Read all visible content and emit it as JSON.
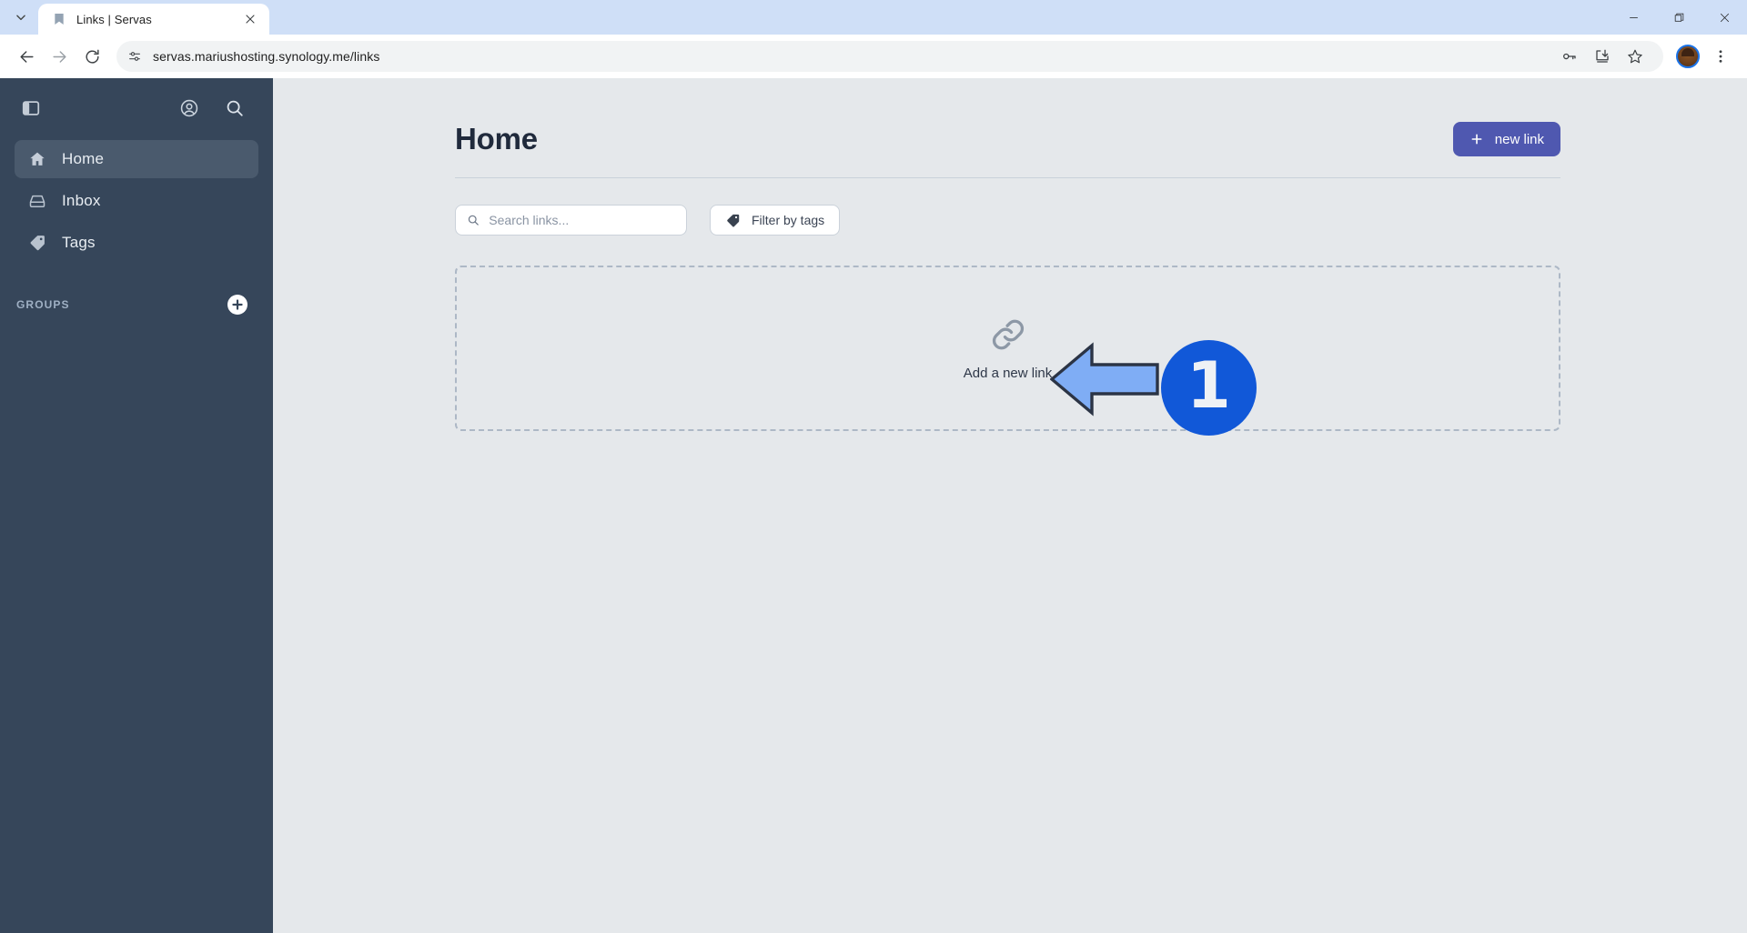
{
  "browser": {
    "tab": {
      "title": "Links | Servas",
      "favicon_name": "servas-bookmark-favicon",
      "close_label": "×"
    },
    "tab_search_label": "Search tabs",
    "toolbar": {
      "back_label": "Back",
      "forward_label": "Forward",
      "reload_label": "Reload",
      "url": "servas.mariushosting.synology.me/links",
      "site_info_label": "View site information",
      "password_label": "Passwords",
      "install_label": "Install Servas",
      "bookmark_label": "Bookmark this tab",
      "profile_label": "Profile",
      "menu_label": "Customize and control Chrome"
    },
    "window_controls": {
      "minimize": "—",
      "maximize": "❐",
      "close": "✕"
    }
  },
  "sidebar": {
    "toggle_label": "Toggle sidebar",
    "account_label": "Account",
    "search_label": "Search",
    "items": [
      {
        "label": "Home",
        "icon": "home-icon",
        "active": true
      },
      {
        "label": "Inbox",
        "icon": "inbox-icon",
        "active": false
      },
      {
        "label": "Tags",
        "icon": "tag-icon",
        "active": false
      }
    ],
    "groups": {
      "title": "GROUPS",
      "add_label": "+"
    }
  },
  "main": {
    "title": "Home",
    "new_link_button": {
      "label": "new link",
      "icon": "plus-icon"
    },
    "search": {
      "placeholder": "Search links...",
      "value": "",
      "icon": "search-icon"
    },
    "filter_button": {
      "label": "Filter by tags",
      "icon": "tag-icon"
    },
    "empty_state": {
      "label": "Add a new link",
      "icon": "chain-link-icon"
    }
  },
  "annotation": {
    "number": "1",
    "arrow_direction": "left",
    "arrow_fill": "#7fadf5",
    "arrow_stroke": "#2b3445",
    "badge_color": "#1158d8"
  },
  "colors": {
    "sidebar_bg": "#36465a",
    "sidebar_active": "#4a5a6d",
    "page_bg": "#e5e8eb",
    "accent": "#4f58b0",
    "title_color": "#202a3c",
    "tabstrip_bg": "#cfdff7"
  }
}
